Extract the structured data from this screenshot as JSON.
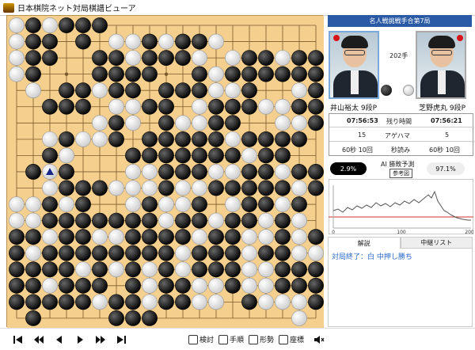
{
  "window": {
    "title": "日本棋院ネット対局棋譜ビューア"
  },
  "match_title": "名人戦挑戦手合第7局",
  "move_count": "202手",
  "players": {
    "black": {
      "name": "井山裕太",
      "rank": "9段P"
    },
    "white": {
      "name": "芝野虎丸",
      "rank": "9段P"
    }
  },
  "stats": {
    "time_left": {
      "label": "残り時間",
      "black": "07:56:53",
      "white": "07:56:21"
    },
    "captures": {
      "label": "アゲハマ",
      "black": "15",
      "white": "5"
    },
    "byoyomi": {
      "label": "秒読み",
      "black": "60秒 10回",
      "white": "60秒 10回"
    }
  },
  "ai": {
    "label": "AI 勝敗予測",
    "reference_button": "参考図",
    "black_pct": "2.9%",
    "white_pct": "97.1%"
  },
  "graph": {
    "x_ticks": [
      "0",
      "",
      "100",
      "",
      "200"
    ],
    "y_marks": [
      "",
      "",
      ""
    ]
  },
  "tabs": [
    {
      "label": "解説"
    },
    {
      "label": "中継リスト"
    }
  ],
  "commentary": "対局終了：白 中押し勝ち",
  "toolbar": {
    "tools": [
      {
        "label": "検討",
        "icon": "study-icon"
      },
      {
        "label": "手順",
        "icon": "sequence-icon"
      },
      {
        "label": "形勢",
        "icon": "position-icon"
      },
      {
        "label": "座標",
        "icon": "coordinate-icon"
      }
    ],
    "mute_icon": "speaker-mute-icon"
  },
  "nav": [
    "first-move-icon",
    "rewind-icon",
    "previous-icon",
    "next-icon",
    "fast-forward-icon",
    "last-move-icon"
  ],
  "board": {
    "size": 19,
    "last_move": {
      "col": 2,
      "row": 9,
      "color": "w"
    },
    "rows": [
      "wbwbbb.............",
      "wbb.b.wwbwbbw......",
      "wbb..bbwbbbw.wbbwbb",
      "wb...bbbb..bwbbbbbb",
      ".w.bbwbb.bbbwwb..wb",
      "..bbb.wwbb.wbbbwwbb",
      ".....wbw.bwwbb..wwb",
      "..wbwwb.bbbbbwbbbb.",
      "..bw...bbbbbbbwbb..",
      ".bwb...wwbbbwwbbwbb",
      "..wbbbwwwbwwbbbbbwb",
      "wwbwb..wbwwb.wbbwb.",
      "wwbbbbbbbwbbwbbwbw.",
      "bbwbbwwbbbbwbbwwbwb",
      "bwbbbbbbbbwbbbwbbww",
      "bbbbwbwbwbwbbbwwbbb",
      "bbwbbb.bwbbwwbwwbbb",
      "bbbbbwbbwbbww.bwwwb",
      ".b....bbb........w."
    ],
    "colors": {
      "wood": "#f4cf8d",
      "line": "#7b5a2a"
    }
  }
}
